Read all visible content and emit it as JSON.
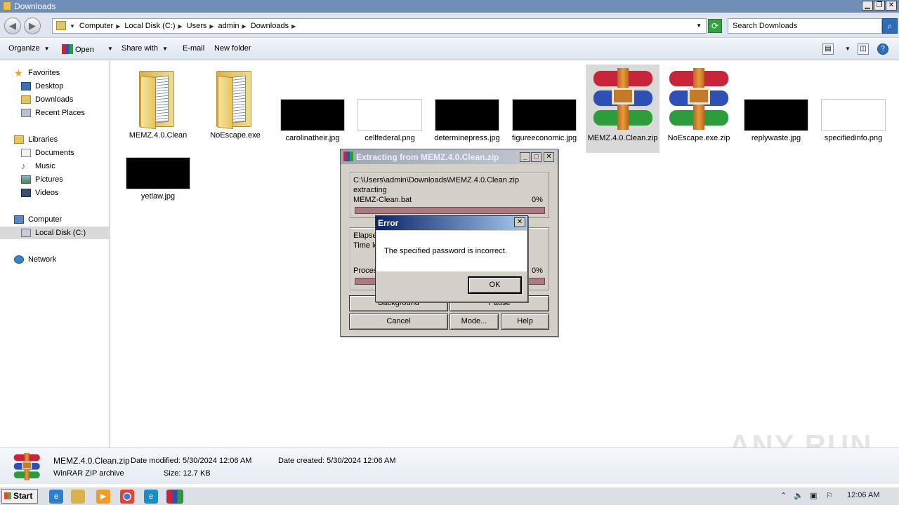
{
  "window": {
    "title": "Downloads"
  },
  "address": {
    "crumbs": [
      "Computer",
      "Local Disk (C:)",
      "Users",
      "admin",
      "Downloads"
    ],
    "search_placeholder": "Search Downloads"
  },
  "toolbar": {
    "organize": "Organize",
    "open": "Open",
    "share_with": "Share with",
    "email": "E-mail",
    "new_folder": "New folder"
  },
  "sidebar": {
    "favorites": "Favorites",
    "desktop": "Desktop",
    "downloads": "Downloads",
    "recent": "Recent Places",
    "libraries": "Libraries",
    "documents": "Documents",
    "music": "Music",
    "pictures": "Pictures",
    "videos": "Videos",
    "computer": "Computer",
    "local_disk": "Local Disk (C:)",
    "network": "Network"
  },
  "files": [
    {
      "name": "MEMZ.4.0.Clean",
      "kind": "folder"
    },
    {
      "name": "NoEscape.exe",
      "kind": "folder"
    },
    {
      "name": "carolinatheir.jpg",
      "kind": "dark-image"
    },
    {
      "name": "cellfederal.png",
      "kind": "light-image"
    },
    {
      "name": "determinepress.jpg",
      "kind": "dark-image"
    },
    {
      "name": "figureeconomic.jpg",
      "kind": "dark-image"
    },
    {
      "name": "MEMZ.4.0.Clean.zip",
      "kind": "winrar-archive"
    },
    {
      "name": "NoEscape.exe.zip",
      "kind": "winrar-archive"
    },
    {
      "name": "replywaste.jpg",
      "kind": "dark-image"
    },
    {
      "name": "specifiedinfo.png",
      "kind": "light-image"
    },
    {
      "name": "yetlaw.jpg",
      "kind": "dark-image"
    }
  ],
  "details": {
    "filename": "MEMZ.4.0.Clean.zip",
    "modified": "Date modified: 5/30/2024 12:06 AM",
    "created": "Date created: 5/30/2024 12:06 AM",
    "type": "WinRAR ZIP archive",
    "size": "Size: 12.7 KB"
  },
  "watermark": "ANY RUN",
  "extract_dialog": {
    "title": "Extracting from MEMZ.4.0.Clean.zip",
    "path": "C:\\Users\\admin\\Downloads\\MEMZ.4.0.Clean.zip",
    "action": "extracting",
    "current_file": "MEMZ-Clean.bat",
    "file_percent": "0%",
    "elapsed": "Elapse",
    "time_left": "Time le",
    "processed": "Proces",
    "total_percent": "0%",
    "background": "Background",
    "pause": "Pause",
    "cancel": "Cancel",
    "mode": "Mode...",
    "help": "Help",
    "file_progress": 0.0,
    "total_progress": 0.0
  },
  "error_dialog": {
    "title": "Error",
    "message": "The specified password is incorrect.",
    "ok": "OK"
  },
  "taskbar": {
    "start": "Start",
    "clock": "12:06 AM"
  }
}
